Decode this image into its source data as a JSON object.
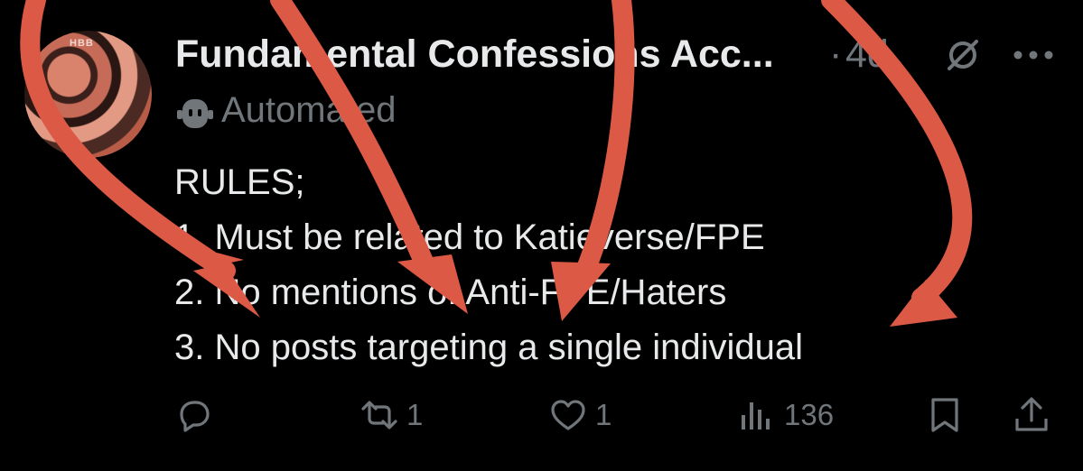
{
  "post": {
    "author_name": "Fundamental Confessions Acc...",
    "separator": "·",
    "time": "4d",
    "automated_label": "Automated",
    "avatar_text": "HBB",
    "body_lines": [
      "RULES;",
      "1. Must be related to Katieverse/FPE",
      "2. No mentions of Anti-FPE/Haters",
      "3. No posts targeting a single individual"
    ]
  },
  "actions": {
    "retweet_count": "1",
    "like_count": "1",
    "views_count": "136"
  },
  "colors": {
    "background": "#000000",
    "text": "#e7e9ea",
    "muted": "#71767b",
    "arrow": "#dc5a45"
  },
  "icons": [
    "grok-icon",
    "more-icon",
    "robot-icon",
    "reply-icon",
    "retweet-icon",
    "like-icon",
    "views-icon",
    "bookmark-icon",
    "share-icon"
  ]
}
